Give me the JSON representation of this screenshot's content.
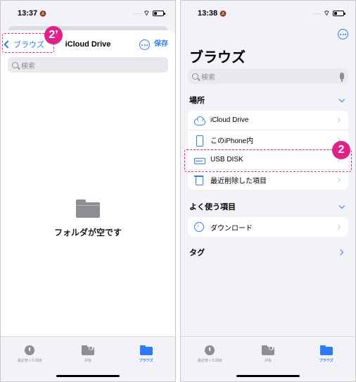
{
  "left": {
    "status": {
      "time": "13:37",
      "mute": "🔕"
    },
    "nav": {
      "back_label": "ブラウズ",
      "title": "iCloud Drive",
      "save_label": "保存"
    },
    "search": {
      "placeholder": "検索"
    },
    "empty_text": "フォルダが空です",
    "annotation": "2’",
    "tabs": [
      {
        "label": "最近使った項目",
        "icon": "clock-icon",
        "active": false
      },
      {
        "label": "共有",
        "icon": "shared-folder-icon",
        "active": false
      },
      {
        "label": "ブラウズ",
        "icon": "folder-icon",
        "active": true
      }
    ]
  },
  "right": {
    "status": {
      "time": "13:38",
      "mute": "🔕"
    },
    "title": "ブラウズ",
    "search": {
      "placeholder": "検索"
    },
    "sections": {
      "locations": {
        "header": "場所",
        "items": [
          {
            "label": "iCloud Drive",
            "icon": "cloud-icon"
          },
          {
            "label": "このiPhone内",
            "icon": "iphone-icon"
          },
          {
            "label": "USB DISK",
            "icon": "drive-icon"
          },
          {
            "label": "最近削除した項目",
            "icon": "trash-icon"
          }
        ]
      },
      "favorites": {
        "header": "よく使う項目",
        "items": [
          {
            "label": "ダウンロード",
            "icon": "download-icon"
          }
        ]
      },
      "tags": {
        "header": "タグ"
      }
    },
    "annotation": "2",
    "tabs": [
      {
        "label": "最近使った項目",
        "icon": "clock-icon",
        "active": false
      },
      {
        "label": "共有",
        "icon": "shared-folder-icon",
        "active": false
      },
      {
        "label": "ブラウズ",
        "icon": "folder-icon",
        "active": true
      }
    ]
  },
  "colors": {
    "accent": "#2f7bf5",
    "annotation": "#e0218a",
    "background": "#f2f2f7"
  }
}
